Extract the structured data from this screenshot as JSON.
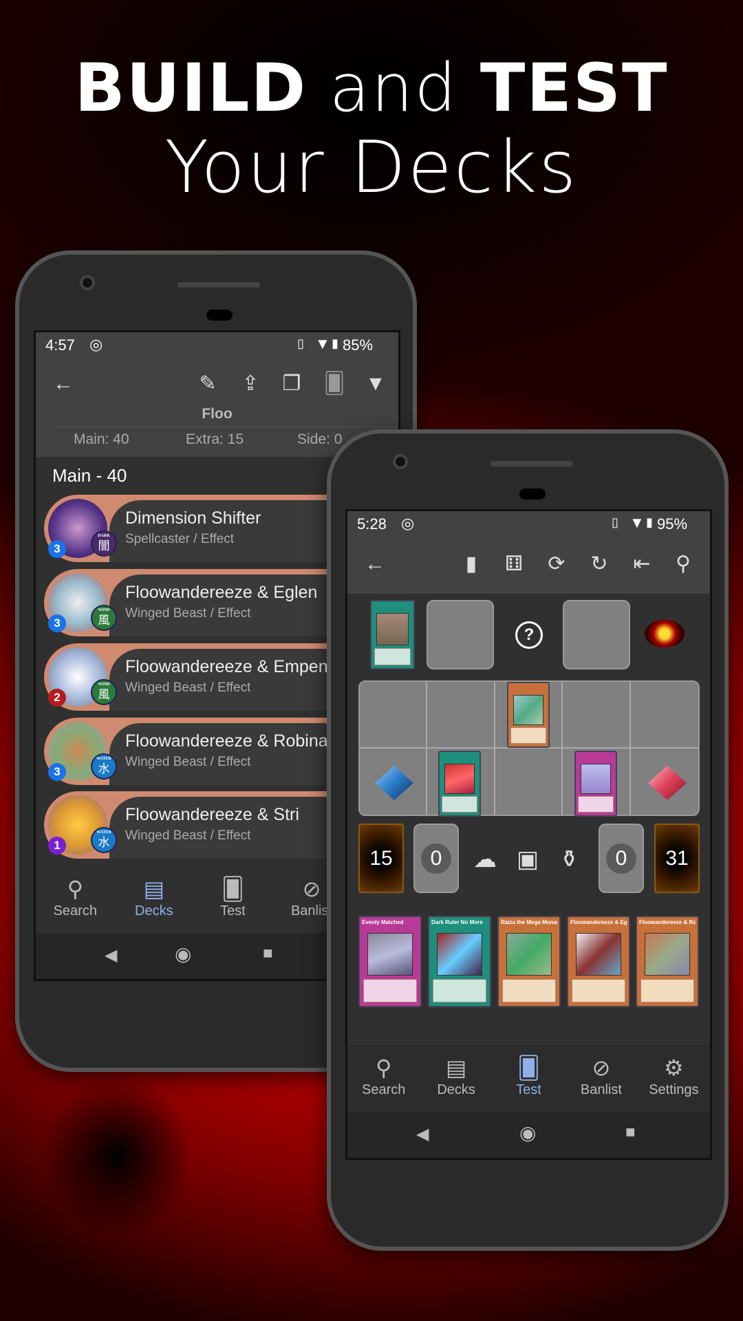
{
  "headline": {
    "build": "BUILD",
    "and": "and",
    "test": "TEST",
    "line2": "Your Decks"
  },
  "left_phone": {
    "status": {
      "time": "4:57",
      "battery": "85%"
    },
    "toolbar_icons": [
      "back-arrow-icon",
      "edit-icon",
      "share-icon",
      "copy-icon",
      "cards-icon",
      "filter-icon"
    ],
    "deck_title": "Floo",
    "counts": {
      "main": "Main: 40",
      "extra": "Extra: 15",
      "side": "Side: 0"
    },
    "section": "Main - 40",
    "cards": [
      {
        "name": "Dimension Shifter",
        "type": "Spellcaster / Effect",
        "count": "3",
        "attribute": "DARK",
        "attr_glyph": "闇",
        "count_color": "#1a73e8"
      },
      {
        "name": "Floowandereeze & Eglen",
        "type": "Winged Beast / Effect",
        "count": "3",
        "attribute": "WIND",
        "attr_glyph": "風",
        "count_color": "#1a73e8"
      },
      {
        "name": "Floowandereeze & Empen",
        "type": "Winged Beast / Effect",
        "count": "2",
        "attribute": "WIND",
        "attr_glyph": "風",
        "count_color": "#b71c1c"
      },
      {
        "name": "Floowandereeze & Robina",
        "type": "Winged Beast / Effect",
        "count": "3",
        "attribute": "WATER",
        "attr_glyph": "水",
        "count_color": "#1a73e8"
      },
      {
        "name": "Floowandereeze & Stri",
        "type": "Winged Beast / Effect",
        "count": "1",
        "attribute": "WATER",
        "attr_glyph": "水",
        "count_color": "#7b1fd0"
      }
    ],
    "nav": [
      {
        "label": "Search",
        "active": false
      },
      {
        "label": "Decks",
        "active": true
      },
      {
        "label": "Test",
        "active": false
      },
      {
        "label": "Banlist",
        "active": false
      }
    ]
  },
  "right_phone": {
    "status": {
      "time": "5:28",
      "battery": "95%"
    },
    "toolbar_icons": [
      "back-arrow-icon",
      "card-icon",
      "coin-dice-icon",
      "shuffle-deck-icon",
      "reset-icon",
      "return-card-icon",
      "search-icon"
    ],
    "deck_count": "15",
    "banished_count": "0",
    "gy_count": "0",
    "extra_count": "31",
    "hand": [
      {
        "name": "Evenly Matched",
        "kind": "trap"
      },
      {
        "name": "Dark Ruler No More",
        "kind": "spell"
      },
      {
        "name": "Raiza the Mega Monarch",
        "kind": "monster"
      },
      {
        "name": "Floowandereeze & Eglen",
        "kind": "monster"
      },
      {
        "name": "Floowandereeze & Robina",
        "kind": "monster"
      }
    ],
    "nav": [
      {
        "label": "Search",
        "active": false
      },
      {
        "label": "Decks",
        "active": false
      },
      {
        "label": "Test",
        "active": true
      },
      {
        "label": "Banlist",
        "active": false
      },
      {
        "label": "Settings",
        "active": false
      }
    ]
  },
  "colors": {
    "accent": "#8fb0e8",
    "background": "#c00000",
    "row_border": "#d08a70"
  }
}
